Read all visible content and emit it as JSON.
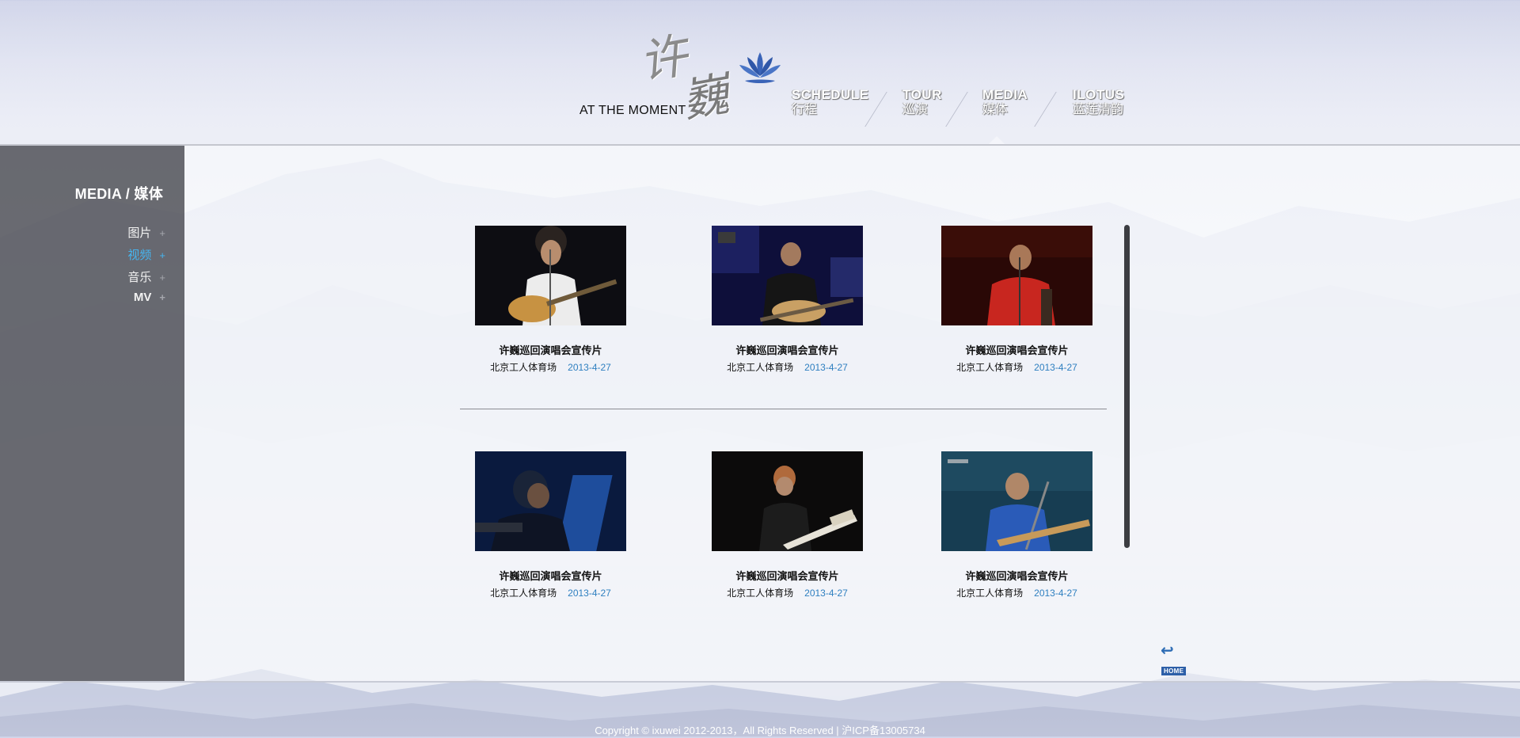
{
  "header": {
    "tagline": "AT THE MOMENT",
    "logo_chars": [
      "许",
      "巍"
    ],
    "nav": [
      {
        "en": "SCHEDULE",
        "cn": "行程"
      },
      {
        "en": "TOUR",
        "cn": "巡演"
      },
      {
        "en": "MEDIA",
        "cn": "媒体"
      },
      {
        "en": "ILOTUS",
        "cn": "蓝莲清韵"
      }
    ],
    "active_nav": "MEDIA"
  },
  "sidebar": {
    "title": "MEDIA / 媒体",
    "items": [
      {
        "label": "图片",
        "plus": "+"
      },
      {
        "label": "视频",
        "plus": "+"
      },
      {
        "label": "音乐",
        "plus": "+"
      },
      {
        "label": "MV",
        "plus": "+"
      }
    ],
    "active_item": "视频"
  },
  "videos": [
    {
      "title": "许巍巡回演唱会宣传片",
      "venue": "北京工人体育场",
      "date": "2013-4-27"
    },
    {
      "title": "许巍巡回演唱会宣传片",
      "venue": "北京工人体育场",
      "date": "2013-4-27"
    },
    {
      "title": "许巍巡回演唱会宣传片",
      "venue": "北京工人体育场",
      "date": "2013-4-27"
    },
    {
      "title": "许巍巡回演唱会宣传片",
      "venue": "北京工人体育场",
      "date": "2013-4-27"
    },
    {
      "title": "许巍巡回演唱会宣传片",
      "venue": "北京工人体育场",
      "date": "2013-4-27"
    },
    {
      "title": "许巍巡回演唱会宣传片",
      "venue": "北京工人体育场",
      "date": "2013-4-27"
    }
  ],
  "home_button": {
    "label": "HOME"
  },
  "footer": {
    "copyright": "Copyright © ixuwei 2012-2013，All Rights Reserved | 沪ICP备13005734"
  },
  "colors": {
    "accent": "#46b5f0",
    "date": "#2e7fc0",
    "sidebar": "#55575d"
  }
}
